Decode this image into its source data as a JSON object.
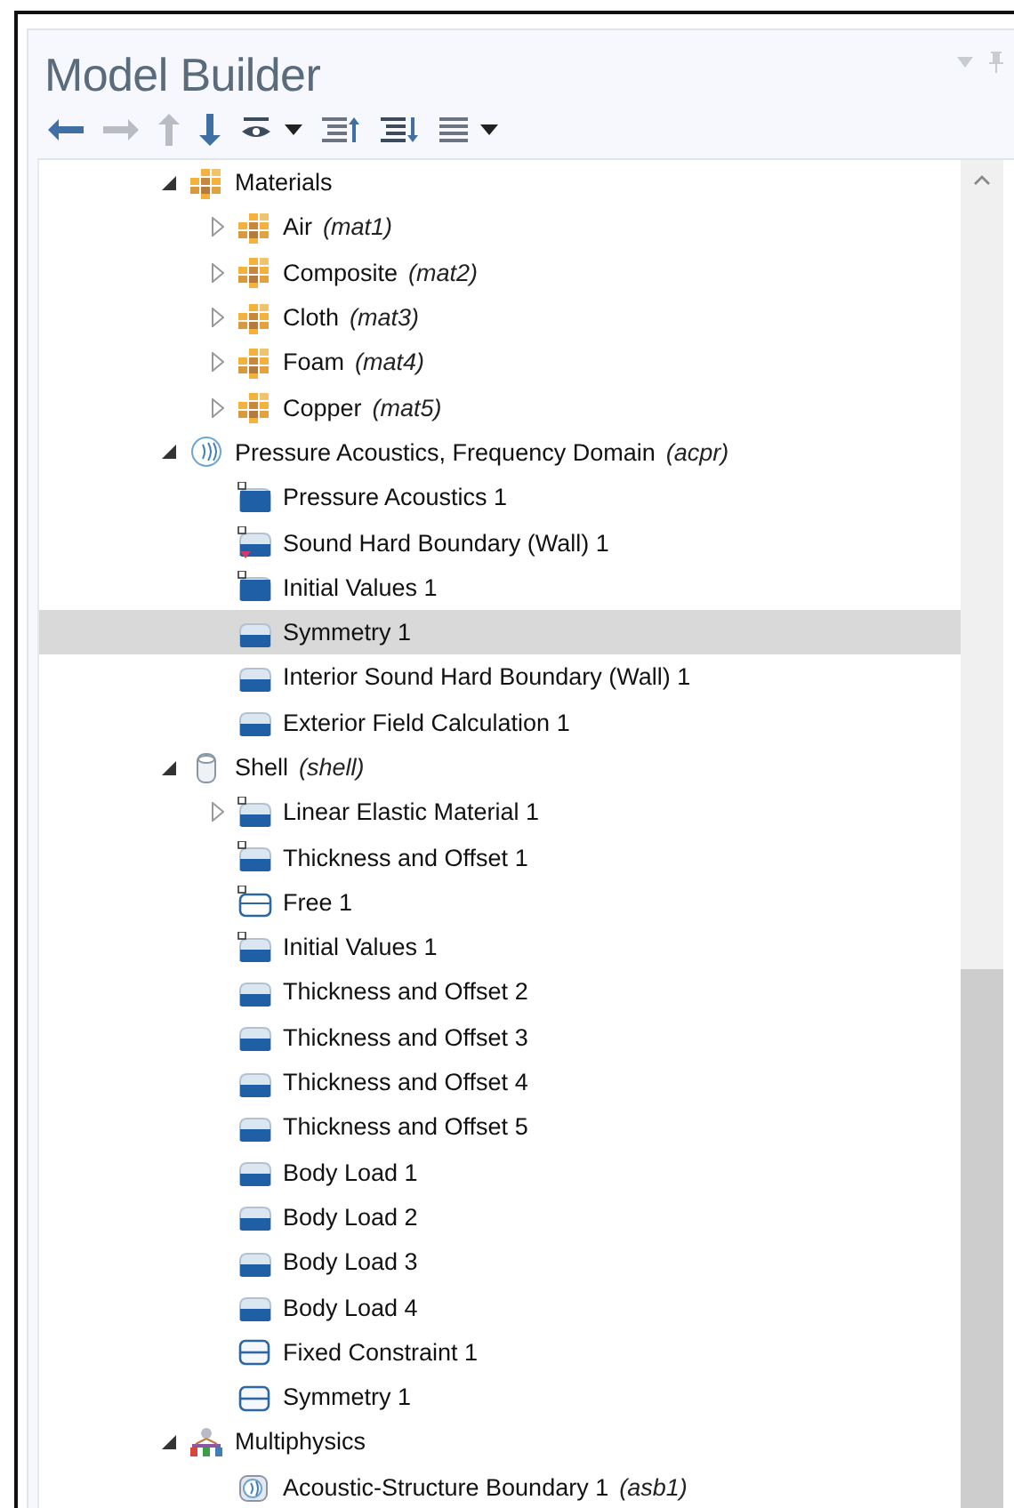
{
  "panel": {
    "title": "Model Builder"
  },
  "toolbar": [
    {
      "kind": "back",
      "disabled": false
    },
    {
      "kind": "forward",
      "disabled": true
    },
    {
      "kind": "up",
      "disabled": true
    },
    {
      "kind": "down",
      "disabled": false
    },
    {
      "kind": "show",
      "disabled": false
    },
    {
      "kind": "caret",
      "disabled": false
    },
    {
      "kind": "collapse",
      "disabled": false
    },
    {
      "kind": "expand",
      "disabled": false
    },
    {
      "kind": "list",
      "disabled": false
    },
    {
      "kind": "caret",
      "disabled": false
    }
  ],
  "tree": [
    {
      "label": "Materials",
      "kind": "materials",
      "expanded": true,
      "selected": false,
      "children": [
        {
          "label": "Air",
          "tag": "(mat1)",
          "kind": "material",
          "expanded": false,
          "selected": false
        },
        {
          "label": "Composite",
          "tag": "(mat2)",
          "kind": "material",
          "expanded": false,
          "selected": false
        },
        {
          "label": "Cloth",
          "tag": "(mat3)",
          "kind": "material",
          "expanded": false,
          "selected": false
        },
        {
          "label": "Foam",
          "tag": "(mat4)",
          "kind": "material",
          "expanded": false,
          "selected": false
        },
        {
          "label": "Copper",
          "tag": "(mat5)",
          "kind": "material",
          "expanded": false,
          "selected": false
        }
      ]
    },
    {
      "label": "Pressure Acoustics, Frequency Domain",
      "tag": "(acpr)",
      "kind": "acoustics",
      "expanded": true,
      "selected": false,
      "children": [
        {
          "label": "Pressure Acoustics 1",
          "kind": "default-domain",
          "selected": false
        },
        {
          "label": "Sound Hard Boundary (Wall) 1",
          "kind": "default-boundary",
          "selected": false
        },
        {
          "label": "Initial Values 1",
          "kind": "default-domain",
          "selected": false
        },
        {
          "label": "Symmetry 1",
          "kind": "boundary",
          "selected": true
        },
        {
          "label": "Interior Sound Hard Boundary (Wall) 1",
          "kind": "boundary",
          "selected": false
        },
        {
          "label": "Exterior Field Calculation 1",
          "kind": "boundary",
          "selected": false
        }
      ]
    },
    {
      "label": "Shell",
      "tag": "(shell)",
      "kind": "shell",
      "expanded": true,
      "selected": false,
      "children": [
        {
          "label": "Linear Elastic Material 1",
          "kind": "default-boundary-plain",
          "expanded": false,
          "selected": false
        },
        {
          "label": "Thickness and Offset 1",
          "kind": "default-boundary-plain",
          "selected": false
        },
        {
          "label": "Free 1",
          "kind": "default-outline",
          "selected": false
        },
        {
          "label": "Initial Values 1",
          "kind": "default-boundary-plain",
          "selected": false
        },
        {
          "label": "Thickness and Offset 2",
          "kind": "boundary",
          "selected": false
        },
        {
          "label": "Thickness and Offset 3",
          "kind": "boundary",
          "selected": false
        },
        {
          "label": "Thickness and Offset 4",
          "kind": "boundary",
          "selected": false
        },
        {
          "label": "Thickness and Offset 5",
          "kind": "boundary",
          "selected": false
        },
        {
          "label": "Body Load 1",
          "kind": "boundary",
          "selected": false
        },
        {
          "label": "Body Load 2",
          "kind": "boundary",
          "selected": false
        },
        {
          "label": "Body Load 3",
          "kind": "boundary",
          "selected": false
        },
        {
          "label": "Body Load 4",
          "kind": "boundary",
          "selected": false
        },
        {
          "label": "Fixed Constraint 1",
          "kind": "edge",
          "selected": false
        },
        {
          "label": "Symmetry 1",
          "kind": "edge",
          "selected": false
        }
      ]
    },
    {
      "label": "Multiphysics",
      "kind": "multiphysics",
      "expanded": true,
      "selected": false,
      "children": [
        {
          "label": "Acoustic-Structure Boundary 1",
          "tag": "(asb1)",
          "kind": "coupling",
          "selected": false
        }
      ]
    }
  ]
}
